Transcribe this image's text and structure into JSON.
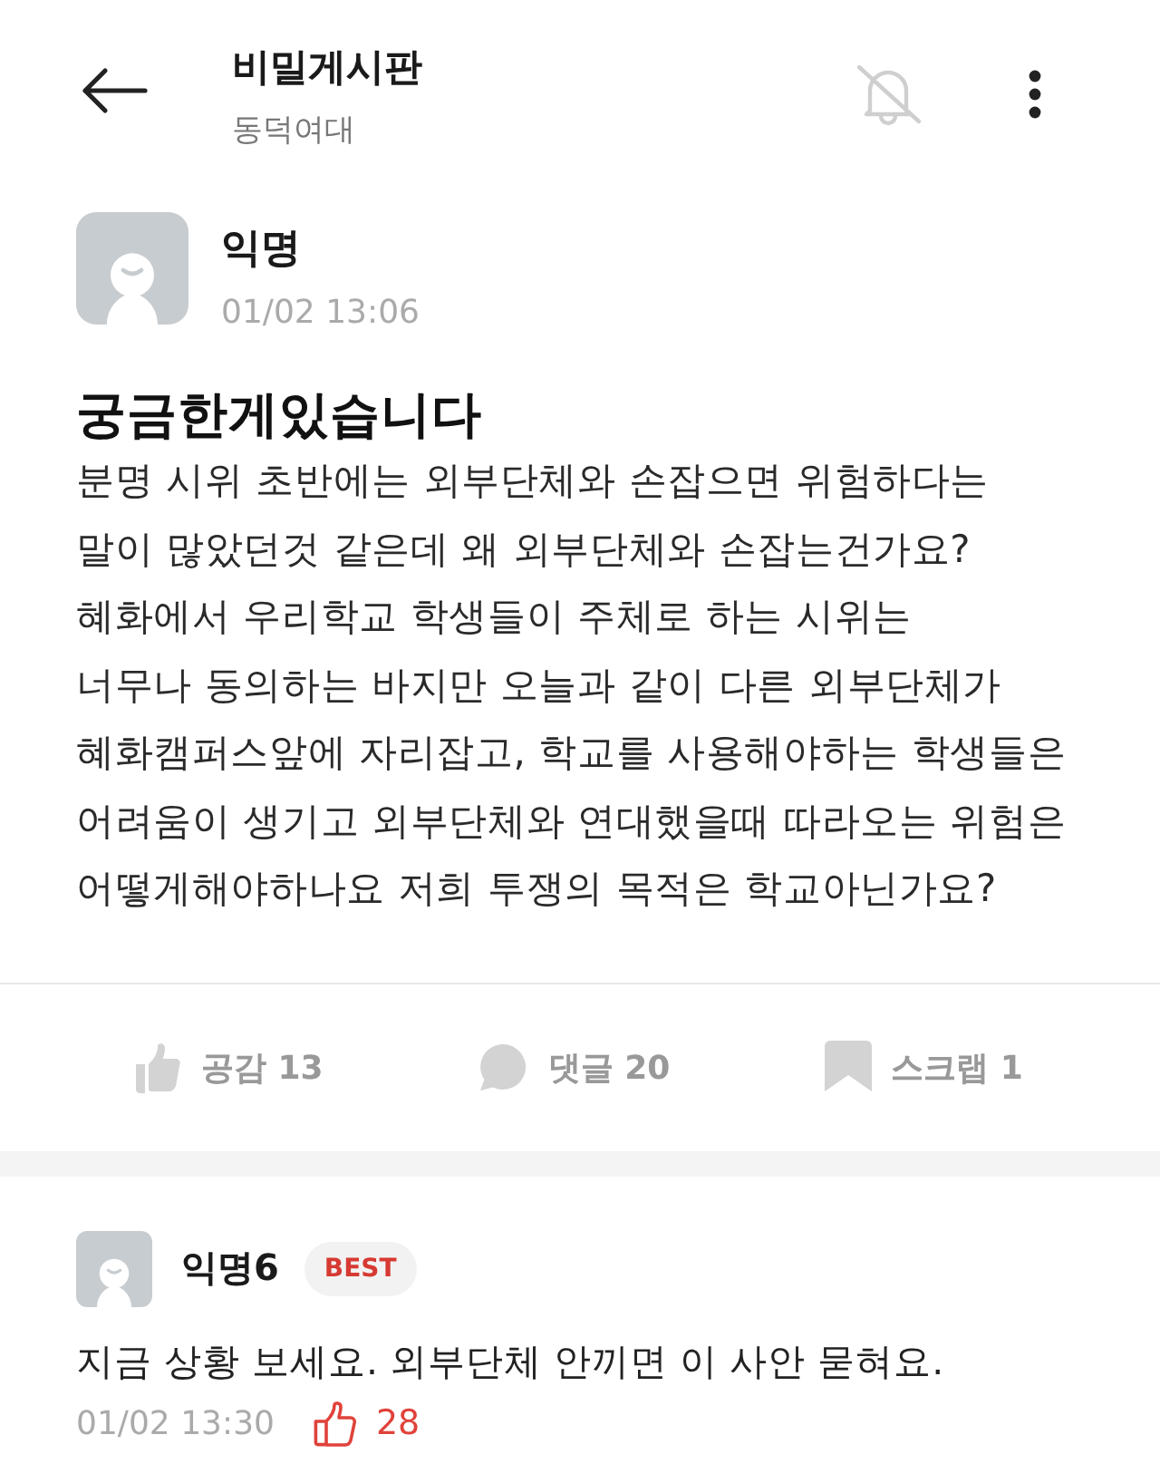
{
  "header": {
    "title": "비밀게시판",
    "subtitle": "동덕여대",
    "notifications_on": false
  },
  "post": {
    "author": "익명",
    "time": "01/02 13:06",
    "title": "궁금한게있습니다",
    "body": "분명 시위 초반에는 외부단체와 손잡으면 위험하다는\n말이 많았던것 같은데 왜 외부단체와 손잡는건가요?\n혜화에서 우리학교 학생들이 주체로 하는 시위는\n너무나 동의하는 바지만 오늘과 같이 다른 외부단체가\n혜화캠퍼스앞에 자리잡고, 학교를 사용해야하는 학생들은\n어려움이 생기고 외부단체와 연대했을때 따라오는 위험은\n어떻게해야하나요 저희 투쟁의 목적은 학교아닌가요?",
    "actions": [
      {
        "kind": "like",
        "label": "공감 13"
      },
      {
        "kind": "comment",
        "label": "댓글 20"
      },
      {
        "kind": "scrap",
        "label": "스크랩 1"
      }
    ]
  },
  "comments": [
    {
      "author": "익명6",
      "badge": "BEST",
      "text": "지금 상황 보세요. 외부단체 안끼면 이 사안 묻혀요.",
      "time": "01/02 13:30",
      "likes": "28"
    }
  ]
}
